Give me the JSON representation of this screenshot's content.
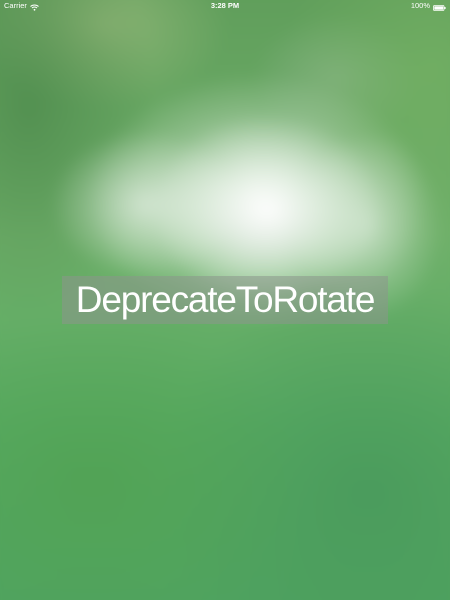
{
  "status_bar": {
    "carrier": "Carrier",
    "time": "3:28 PM",
    "battery_percent": "100%",
    "battery_level": 1.0,
    "icons": [
      "wifi-icon",
      "battery-icon"
    ]
  },
  "main": {
    "title": "DeprecateToRotate"
  },
  "colors": {
    "background_green": "#5aa865",
    "title_box": "#8c968c",
    "text": "#ffffff"
  }
}
